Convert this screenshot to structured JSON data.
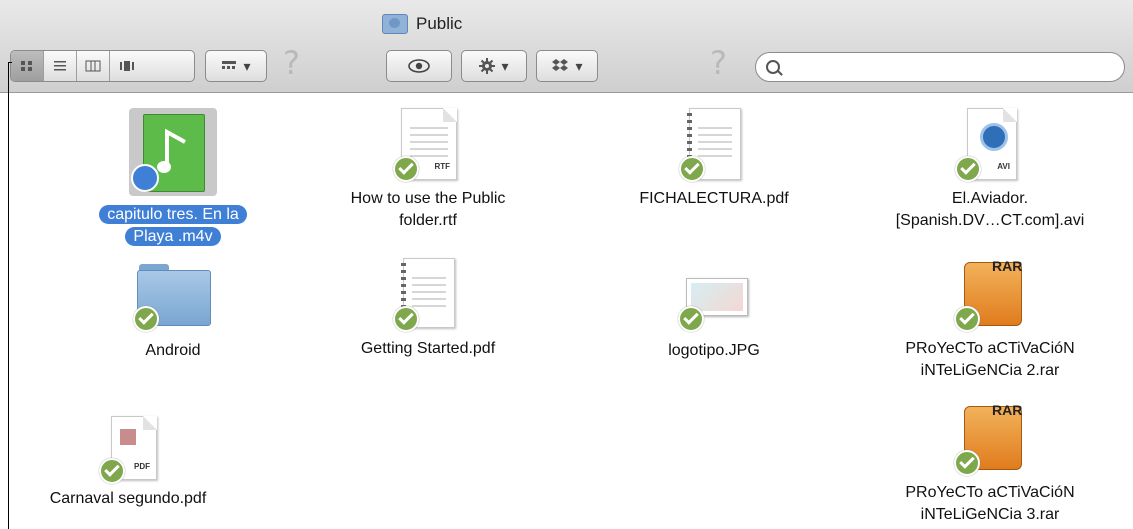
{
  "window": {
    "title": "Public"
  },
  "toolbar": {
    "view_buttons": [
      {
        "name": "icon-view-button",
        "icon": "icon-grid-icon"
      },
      {
        "name": "list-view-button",
        "icon": "list-icon"
      },
      {
        "name": "column-view-button",
        "icon": "columns-icon"
      },
      {
        "name": "coverflow-view-button",
        "icon": "coverflow-icon"
      }
    ],
    "arrange_icon": "arrange-grid-icon",
    "quicklook_icon": "eye-icon",
    "action_icon": "gear-icon",
    "dropbox_icon": "dropbox-icon",
    "help_glyph": "?",
    "dropdown_glyph": "▾",
    "search": {
      "placeholder": "",
      "value": ""
    }
  },
  "colors": {
    "selection": "#3f7fd6",
    "sync_check": "#7fa84c",
    "music_file": "#5dbb4a",
    "folder": "#8fb4d8"
  },
  "files": [
    {
      "name": "capitulo tres. En la Playa .m4v",
      "lines": [
        "capitulo tres. En la",
        "Playa .m4v"
      ],
      "icon": "music-file-icon",
      "selected": true
    },
    {
      "name": "How to use the Public folder.rtf",
      "lines": [
        "How to use the Public",
        "folder.rtf"
      ],
      "icon": "rtf-document-icon",
      "tag": "RTF"
    },
    {
      "name": "FICHALECTURA.pdf",
      "lines": [
        "FICHALECTURA.pdf"
      ],
      "icon": "pdf-document-icon"
    },
    {
      "name": "El.Aviador.[Spanish.DV…CT.com].avi",
      "lines": [
        "El.Aviador.",
        "[Spanish.DV…CT.com].avi"
      ],
      "icon": "quicktime-avi-icon",
      "tag": "AVI"
    },
    {
      "name": "Android",
      "lines": [
        "Android"
      ],
      "icon": "folder-icon"
    },
    {
      "name": "Getting Started.pdf",
      "lines": [
        "Getting Started.pdf"
      ],
      "icon": "pdf-document-icon"
    },
    {
      "name": "logotipo.JPG",
      "lines": [
        "logotipo.JPG"
      ],
      "icon": "image-file-icon"
    },
    {
      "name": "PRoYeCTo aCTiVaCióN iNTeLiGeNCia 2.rar",
      "lines": [
        "PRoYeCTo aCTiVaCióN",
        "iNTeLiGeNCia 2.rar"
      ],
      "icon": "rar-archive-icon",
      "tag": "RAR"
    },
    {
      "name": "Carnaval segundo.pdf",
      "lines": [
        "Carnaval segundo.pdf"
      ],
      "icon": "pdf-document-icon",
      "tag": "PDF"
    },
    {
      "name": "PRoYeCTo aCTiVaCióN iNTeLiGeNCia 3.rar",
      "lines": [
        "PRoYeCTo aCTiVaCióN",
        "iNTeLiGeNCia 3.rar"
      ],
      "icon": "rar-archive-icon",
      "tag": "RAR"
    }
  ]
}
